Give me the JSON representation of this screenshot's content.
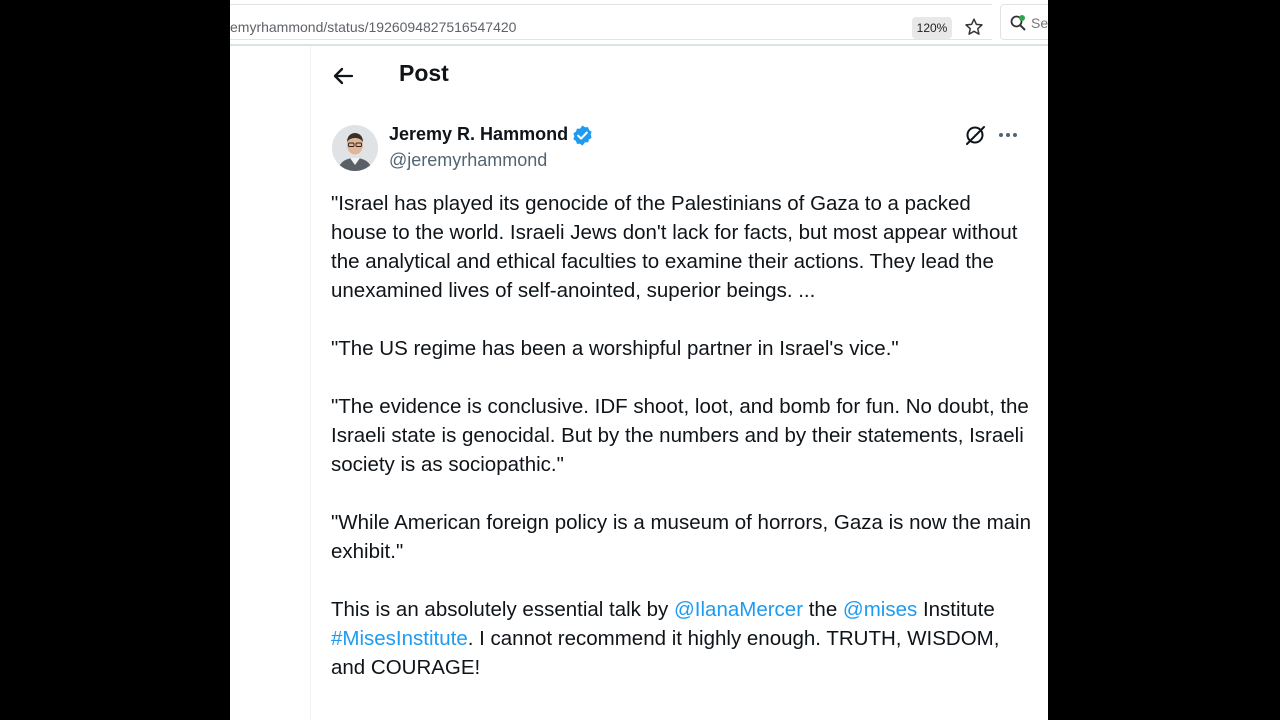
{
  "browser": {
    "url": "emyrhammond/status/1926094827516547420",
    "zoom": "120%",
    "search_placeholder": "Sea"
  },
  "header": {
    "title": "Post"
  },
  "author": {
    "name": "Jeremy R. Hammond",
    "handle": "@jeremyrhammond"
  },
  "post": {
    "p1": "\"Israel has played its genocide of the Palestinians of Gaza to a packed house to the world. Israeli Jews don't lack for facts, but most appear without the analytical and ethical faculties to examine their actions. They lead the unexamined lives of self-anointed, superior beings. ...",
    "p2": "\"The US regime has been a worshipful partner in Israel's vice.\"",
    "p3": "\"The evidence is conclusive. IDF shoot, loot, and bomb for fun. No doubt, the Israeli state is genocidal. But by the numbers and by their statements, Israeli society is as sociopathic.\"",
    "p4": "\"While American foreign policy is a museum of horrors, Gaza is now the main exhibit.\"",
    "p5": {
      "t1": "This is an absolutely essential talk by ",
      "mention1": "@IlanaMercer",
      "t2": " the ",
      "mention2": "@mises",
      "t3": " Institute ",
      "hashtag": "#MisesInstitute",
      "t4": ". I cannot recommend it highly enough. TRUTH, WISDOM, and COURAGE!"
    }
  },
  "colors": {
    "link": "#1d9bf0",
    "text": "#0f1419",
    "secondary": "#536471"
  },
  "icons": [
    "star-icon",
    "search-icon",
    "back-arrow-icon",
    "verified-icon",
    "grok-icon",
    "more-icon"
  ]
}
